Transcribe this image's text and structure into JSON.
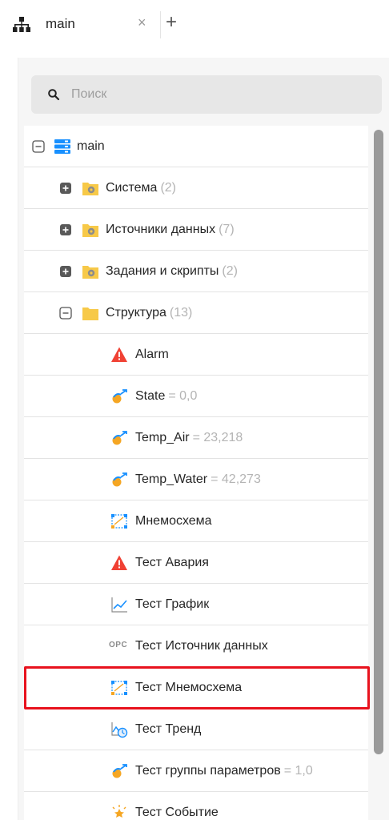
{
  "tab": {
    "label": "main",
    "close": "×",
    "add": "+"
  },
  "search": {
    "placeholder": "Поиск",
    "value": ""
  },
  "tree": {
    "root": {
      "label": "main"
    },
    "groups": [
      {
        "label": "Система",
        "count": "(2)"
      },
      {
        "label": "Источники данных",
        "count": "(7)"
      },
      {
        "label": "Задания и скрипты",
        "count": "(2)"
      },
      {
        "label": "Структура",
        "count": "(13)"
      }
    ],
    "items": [
      {
        "label": "Alarm",
        "value": "",
        "icon": "alarm-icon"
      },
      {
        "label": "State",
        "value": "= 0,0",
        "icon": "variable-icon"
      },
      {
        "label": "Temp_Air",
        "value": "= 23,218",
        "icon": "variable-icon"
      },
      {
        "label": "Temp_Water",
        "value": "= 42,273",
        "icon": "variable-icon"
      },
      {
        "label": "Мнемосхема",
        "value": "",
        "icon": "mnemo-icon"
      },
      {
        "label": "Тест Авария",
        "value": "",
        "icon": "alarm-icon"
      },
      {
        "label": "Тест График",
        "value": "",
        "icon": "chart-icon"
      },
      {
        "label": "Тест Источник данных",
        "value": "",
        "icon": "opc-icon"
      },
      {
        "label": "Тест Мнемосхема",
        "value": "",
        "icon": "mnemo-icon"
      },
      {
        "label": "Тест Тренд",
        "value": "",
        "icon": "trend-icon"
      },
      {
        "label": "Тест группы параметров",
        "value": "= 1,0",
        "icon": "variable-icon"
      },
      {
        "label": "Тест Событие",
        "value": "",
        "icon": "event-icon"
      }
    ],
    "opc_text": "OPC"
  },
  "colors": {
    "accent": "#1890ff",
    "folder": "#f7c948",
    "alarm": "#f04134",
    "selection_outline": "#e8121d"
  }
}
